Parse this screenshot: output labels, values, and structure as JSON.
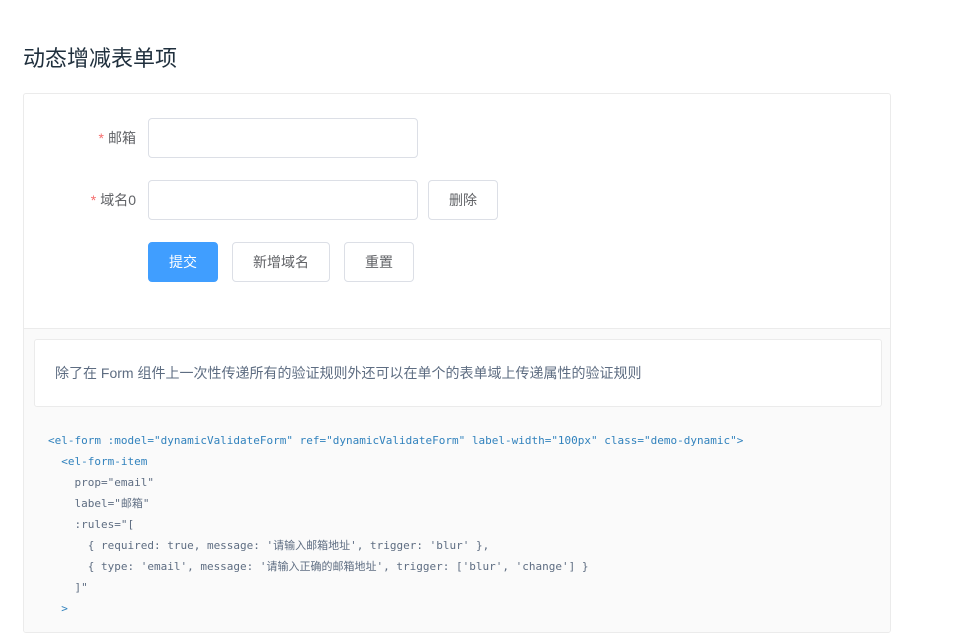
{
  "page": {
    "title": "动态增减表单项"
  },
  "form": {
    "email_field": {
      "required_mark": "*",
      "label": "邮箱",
      "value": ""
    },
    "domain_field": {
      "required_mark": "*",
      "label": "域名0",
      "value": "",
      "delete_label": "删除"
    },
    "actions": {
      "submit_label": "提交",
      "add_domain_label": "新增域名",
      "reset_label": "重置"
    }
  },
  "meta": {
    "description": "除了在 Form 组件上一次性传递所有的验证规则外还可以在单个的表单域上传递属性的验证规则",
    "code_lines": [
      "<el-form :model=\"dynamicValidateForm\" ref=\"dynamicValidateForm\" label-width=\"100px\" class=\"demo-dynamic\">",
      "  <el-form-item",
      "    prop=\"email\"",
      "    label=\"邮箱\"",
      "    :rules=\"[",
      "      { required: true, message: '请输入邮箱地址', trigger: 'blur' },",
      "      { type: 'email', message: '请输入正确的邮箱地址', trigger: ['blur', 'change'] }",
      "    ]\"",
      "  >"
    ]
  },
  "colors": {
    "primary": "#409eff",
    "required": "#f56c6c",
    "code_tag": "#3182bd"
  }
}
